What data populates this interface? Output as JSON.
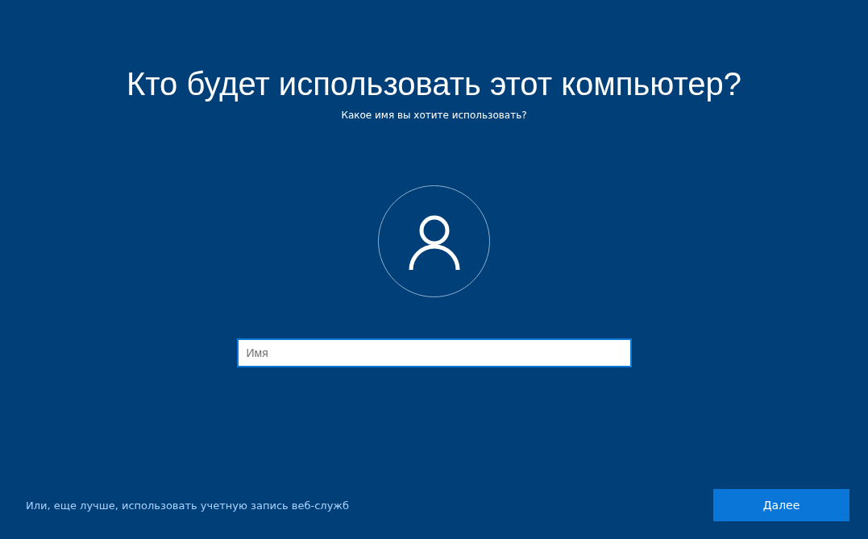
{
  "title": "Кто будет использовать этот компьютер?",
  "subtitle": "Какое имя вы хотите использовать?",
  "name_field": {
    "placeholder": "Имя"
  },
  "alternative_link": "Или, еще лучше, использовать учетную запись веб-служб",
  "buttons": [
    {
      "label": "Далее"
    }
  ]
}
